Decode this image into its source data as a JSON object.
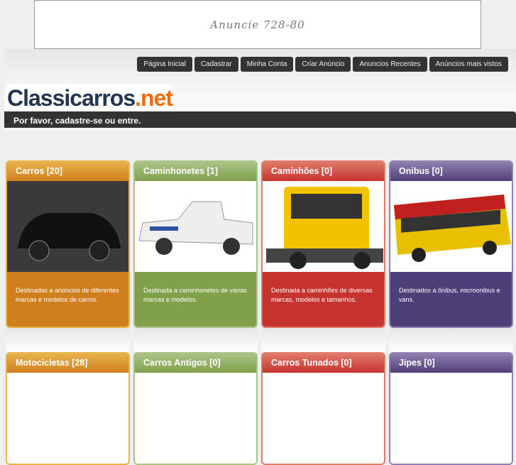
{
  "ad": {
    "text": "Anuncie 728-80"
  },
  "nav": [
    "Página Inicial",
    "Cadastrar",
    "Minha Conta",
    "Criar Anúncio",
    "Anuncios Recentes",
    "Anúncios mais vistos"
  ],
  "logo": {
    "main": "Classicarros",
    "tld": ".net"
  },
  "login_bar": "Por favor, cadastre-se ou entre.",
  "categories": [
    {
      "title": "Carros [20]",
      "desc": "Destinadas a anúncios de diferentes marcas e modelos de carros.",
      "color": "#d07f1e",
      "light": "#e8b24a"
    },
    {
      "title": "Caminhonetes [1]",
      "desc": "Destinada a caminhonetes de várias marcas e modelos.",
      "color": "#80a04a",
      "light": "#aac488"
    },
    {
      "title": "Caminhões [0]",
      "desc": "Destinada a caminhões de diversas marcas, modelos e tamanhos.",
      "color": "#c6332e",
      "light": "#e07a6a"
    },
    {
      "title": "Onibus [0]",
      "desc": "Destinados a ônibus, microonibus e vans.",
      "color": "#4f3f78",
      "light": "#8f80b0"
    },
    {
      "title": "Motocicletas [28]",
      "color": "#d07f1e",
      "light": "#e8b24a"
    },
    {
      "title": "Carros Antigos [0]",
      "color": "#80a04a",
      "light": "#aac488"
    },
    {
      "title": "Carros Tunados [0]",
      "color": "#c6332e",
      "light": "#e07a6a"
    },
    {
      "title": "Jipes [0]",
      "color": "#4f3f78",
      "light": "#8f80b0"
    }
  ]
}
